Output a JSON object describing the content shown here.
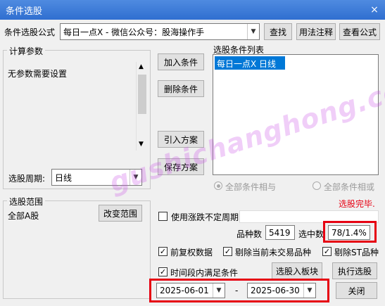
{
  "window": {
    "title": "条件选股",
    "close_glyph": "×"
  },
  "formula": {
    "label": "条件选股公式",
    "value": "每日一点X  -  微信公众号：股海操作手",
    "find_label": "查找",
    "usage_label": "用法注释",
    "view_label": "查看公式"
  },
  "params": {
    "group_title": "计算参数",
    "text": "无参数需要设置"
  },
  "period": {
    "label": "选股周期:",
    "value": "日线"
  },
  "conditions": {
    "add_label": "加入条件",
    "delete_label": "删除条件",
    "import_label": "引入方案",
    "save_label": "保存方案",
    "list_title": "选股条件列表",
    "items": [
      "每日一点X  日线"
    ],
    "and_label": "全部条件相与",
    "or_label": "全部条件相或"
  },
  "status": {
    "done_text": "选股完毕."
  },
  "range": {
    "group_title": "选股范围",
    "value": "全部A股",
    "change_label": "改变范围"
  },
  "options": {
    "variable_period_label": "使用涨跌不定周期",
    "variable_period_checked": false,
    "count_label": "品种数",
    "count_value": "5419",
    "selected_label": "选中数",
    "selected_value": "78/1.4%",
    "restore_rights_label": "前复权数据",
    "restore_rights_checked": true,
    "exclude_untraded_label": "剔除当前未交易品种",
    "exclude_untraded_checked": true,
    "exclude_st_label": "剔除ST品种",
    "exclude_st_checked": true,
    "time_range_label": "时间段内满足条件",
    "time_range_checked": true,
    "check_glyph": "✓"
  },
  "actions": {
    "to_block_label": "选股入板块",
    "run_label": "执行选股",
    "close_label": "关闭"
  },
  "dates": {
    "start": "2025-06-01",
    "end": "2025-06-30",
    "separator": "-"
  },
  "watermark": {
    "text": "gushichanghong.com"
  },
  "colors": {
    "title_bar": "#2f6fd0",
    "highlight": "#e60012",
    "selection": "#0078d7"
  }
}
